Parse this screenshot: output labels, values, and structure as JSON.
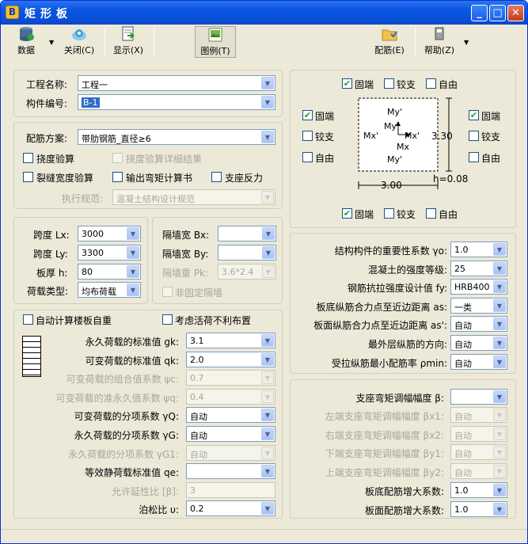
{
  "window": {
    "title": "矩形板",
    "app_icon": "B"
  },
  "toolbar": {
    "data": "数据",
    "close": "关闭(C)",
    "display": "显示(X)",
    "legend": "图例(T)",
    "rebar": "配筋(E)",
    "help": "帮助(Z)"
  },
  "basic": {
    "name_label": "工程名称:",
    "name_value": "工程一",
    "code_label": "构件编号:",
    "code_value": "B-1"
  },
  "scheme": {
    "label": "配筋方案:",
    "value": "带肋钢筋_直径≥6",
    "deflection": "挠度验算",
    "deflection_detail": "挠度验算详细结果",
    "crack": "裂缝宽度验算",
    "output_moment": "输出弯矩计算书",
    "support_reaction": "支座反力",
    "code_label": "执行规范:",
    "code_value": "混凝土结构设计规范"
  },
  "diagram": {
    "top": {
      "fixed": "固端",
      "hinged": "铰支",
      "free": "自由"
    },
    "left": {
      "fixed": "固端",
      "hinged": "铰支",
      "free": "自由"
    },
    "right": {
      "fixed": "固端",
      "hinged": "铰支",
      "free": "自由"
    },
    "bottom": {
      "fixed": "固端",
      "hinged": "铰支",
      "free": "自由"
    },
    "my_top": "My'",
    "my_center": "My",
    "mx_left": "Mx'",
    "mx_right": "Mx'",
    "mx_center": "Mx",
    "my_bottom": "My'",
    "dim_x": "3.00",
    "dim_y": "3.30",
    "h": "h=0.08"
  },
  "geometry": {
    "lx_label": "跨度 Lx:",
    "lx_value": "3000",
    "ly_label": "跨度 Ly:",
    "ly_value": "3300",
    "h_label": "板厚 h:",
    "h_value": "80",
    "load_type_label": "荷载类型:",
    "load_type_value": "均布荷载"
  },
  "wall": {
    "bx_label": "隔墙宽 Bx:",
    "by_label": "隔墙宽 By:",
    "pk_label": "隔墙重 Pk:",
    "pk_value": "3.6*2.4",
    "unfixed": "非固定隔墙"
  },
  "material": {
    "gamma0_label": "结构构件的重要性系数 γo:",
    "gamma0_value": "1.0",
    "concrete_label": "混凝土的强度等级:",
    "concrete_value": "25",
    "fy_label": "钢筋抗拉强度设计值 fy:",
    "fy_value": "HRB400",
    "as_label": "板底纵筋合力点至近边距离 as:",
    "as_value": "一类",
    "as2_label": "板面纵筋合力点至近边距离 as':",
    "as2_value": "自动",
    "direction_label": "最外层纵筋的方向:",
    "direction_value": "自动",
    "rho_label": "受拉纵筋最小配筋率 ρmin:",
    "rho_value": "自动"
  },
  "loads": {
    "auto_selfweight": "自动计算楼板自重",
    "live_unfavorable": "考虑活荷不利布置",
    "gk_label": "永久荷载的标准值 gk:",
    "gk_value": "3.1",
    "qk_label": "可变荷载的标准值 qk:",
    "qk_value": "2.0",
    "psic_label": "可变荷载的组合值系数 ψc:",
    "psic_value": "0.7",
    "psiq_label": "可变荷载的准永久值系数 ψq:",
    "psiq_value": "0.4",
    "gammaQ_label": "可变荷载的分项系数 γQ:",
    "gammaQ_value": "自动",
    "gammaG_label": "永久荷载的分项系数 γG:",
    "gammaG_value": "自动",
    "gammaG1_label": "永久荷载的分项系数 γG1:",
    "gammaG1_value": "自动",
    "qe_label": "等效静荷载标准值 qe:",
    "qe_value": "",
    "beta_label": "允许延性比 [β]:",
    "beta_value": "3",
    "nu_label": "泊松比 υ:",
    "nu_value": "0.2"
  },
  "adjust": {
    "beta_label": "支座弯矩调幅幅度 β:",
    "beta_value": "",
    "bx1_label": "左端支座弯矩调幅幅度 βx1:",
    "bx1_value": "自动",
    "bx2_label": "右端支座弯矩调幅幅度 βx2:",
    "bx2_value": "自动",
    "by1_label": "下端支座弯矩调幅幅度 βy1:",
    "by1_value": "自动",
    "by2_label": "上端支座弯矩调幅幅度 βy2:",
    "by2_value": "自动",
    "bottom_factor_label": "板底配筋增大系数:",
    "bottom_factor_value": "1.0",
    "top_factor_label": "板面配筋增大系数:",
    "top_factor_value": "1.0"
  }
}
